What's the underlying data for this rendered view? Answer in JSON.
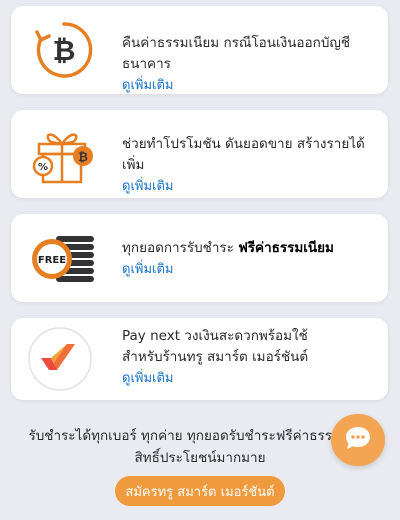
{
  "cards": [
    {
      "title": "คืนค่าธรรมเนียม กรณีโอนเงินออกบัญชีธนาคาร",
      "link": "ดูเพิ่มเติม",
      "icon": "bitcoin-refund-icon"
    },
    {
      "title": "ช่วยทำโปรโมชัน ดันยอดขาย สร้างรายได้เพิ่ม",
      "link": "ดูเพิ่มเติม",
      "icon": "gift-box-icon"
    },
    {
      "title_prefix": "ทุกยอดการรับชำระ ",
      "title_bold": "ฟรีค่าธรรมเนียม",
      "link": "ดูเพิ่มเติม",
      "icon": "free-coins-icon",
      "icon_text": "FREE"
    },
    {
      "title_line1": "Pay next วงเงินสะดวกพร้อมใช้",
      "title_line2": "สำหรับร้านทรู สมาร์ต เมอร์ชันต์",
      "link": "ดูเพิ่มเติม",
      "icon": "pay-next-logo-icon"
    }
  ],
  "footer": {
    "line1": "รับชำระได้ทุกเบอร์ ทุกค่าย ทุกยอดรับชำระฟรีค่าธรรมเนียม",
    "line2": "สิทธิ์ประโยชน์มากมาย",
    "cta_label": "สมัครทรู สมาร์ต เมอร์ชันต์"
  },
  "chat": {
    "icon": "chat-bubble-icon"
  },
  "colors": {
    "accent": "#f09a3e",
    "link": "#1a73c8",
    "background": "#e9ebf1"
  }
}
